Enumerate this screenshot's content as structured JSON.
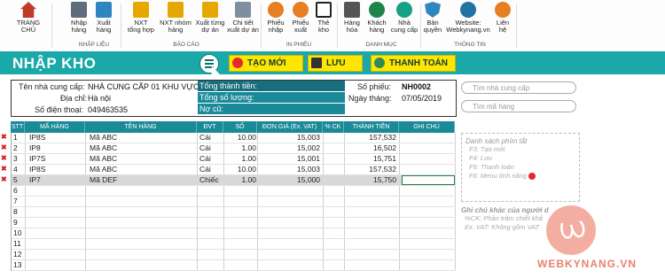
{
  "ribbon": {
    "buttons": [
      {
        "id": "trang-chu",
        "label": "TRANG\nCHỦ",
        "icon": "house-icon",
        "color": "#c0392b"
      },
      {
        "id": "nhap-hang",
        "label": "Nhập\nhàng",
        "icon": "pallet-import-icon",
        "color": "#5d6d7e"
      },
      {
        "id": "xuat-hang",
        "label": "Xuất\nhàng",
        "icon": "cart-export-icon",
        "color": "#2e86c1"
      },
      {
        "id": "nxt-tong-hop",
        "label": "NXT\ntổng hợp",
        "icon": "doc-summary-icon",
        "color": "#e6a700"
      },
      {
        "id": "nxt-nhom-hang",
        "label": "NXT nhóm\nhàng",
        "icon": "doc-group-icon",
        "color": "#e6a700"
      },
      {
        "id": "xuat-tung-du-an",
        "label": "Xuất từng\ndự án",
        "icon": "doc-project-icon",
        "color": "#e6a700"
      },
      {
        "id": "chi-tiet-xuat-du-an",
        "label": "Chi tiết\nxuất dự án",
        "icon": "doc-detail-icon",
        "color": "#7d8fa1"
      },
      {
        "id": "phieu-nhap",
        "label": "Phiếu\nnhập",
        "icon": "import-slip-icon",
        "color": "#e67e22"
      },
      {
        "id": "phieu-xuat",
        "label": "Phiếu\nxuất",
        "icon": "export-slip-icon",
        "color": "#e67e22"
      },
      {
        "id": "the-kho",
        "label": "Thẻ\nkho",
        "icon": "warehouse-card-icon",
        "color": "#222222"
      },
      {
        "id": "hang-hoa",
        "label": "Hàng\nhóa",
        "icon": "goods-icon",
        "color": "#555555"
      },
      {
        "id": "khach-hang",
        "label": "Khách\nhàng",
        "icon": "customers-icon",
        "color": "#1e8449"
      },
      {
        "id": "nha-cung-cap",
        "label": "Nhà\ncung cấp",
        "icon": "supplier-icon",
        "color": "#16a085"
      },
      {
        "id": "ban-quyen",
        "label": "Bản\nquyền",
        "icon": "shield-icon",
        "color": "#2e86c1"
      },
      {
        "id": "website",
        "label": "Website:\nWebkynang.vn",
        "icon": "globe-icon",
        "color": "#2471a3"
      },
      {
        "id": "lien-he",
        "label": "Liên\nhệ",
        "icon": "contact-icon",
        "color": "#e67e22"
      }
    ],
    "groups": [
      "NHẬP LIỆU",
      "BÁO CÁO",
      "IN PHIẾU",
      "DANH MỤC",
      "THÔNG TIN"
    ]
  },
  "header": {
    "title": "NHẬP KHO",
    "btn_new": "TẠO MỚI",
    "btn_save": "LƯU",
    "btn_pay": "THANH TOÁN",
    "accent": "#1aa8a8",
    "button_color": "#ffe600"
  },
  "info": {
    "supplier_label": "Tên nhà cung cấp:",
    "supplier_value": "NHÀ CUNG CẤP 01 KHU VỰC",
    "address_label": "Địa chỉ:",
    "address_value": "Hà nội",
    "phone_label": "Số điện thoại:",
    "phone_value": "049463535",
    "total_money_label": "Tổng thành tiền:",
    "total_qty_label": "Tổng số lượng:",
    "debt_label": "Nợ cũ:",
    "slip_no_label": "Số phiếu:",
    "slip_no_value": "NH0002",
    "date_label": "Ngày tháng:",
    "date_value": "07/05/2019"
  },
  "search": {
    "supplier_placeholder": "Tìm nhà cung cấp",
    "item_placeholder": "Tìm mã hàng"
  },
  "table": {
    "headers": [
      "STT",
      "MÃ HÀNG",
      "TÊN HÀNG",
      "ĐVT",
      "SỐ LƯỢNG",
      "ĐƠN GIÁ (Ex. VAT)",
      "% CK",
      "THÀNH TIỀN",
      "GHI CHÚ"
    ],
    "rows": [
      [
        "1",
        "IP8S",
        "Mã ABC",
        "Cái",
        "10.00",
        "15,003",
        "",
        "157,532",
        ""
      ],
      [
        "2",
        "IP8",
        "Mã ABC",
        "Cái",
        "1.00",
        "15,002",
        "",
        "16,502",
        ""
      ],
      [
        "3",
        "IP7S",
        "Mã ABC",
        "Cái",
        "1.00",
        "15,001",
        "",
        "15,751",
        ""
      ],
      [
        "4",
        "IP8S",
        "Mã ABC",
        "Cái",
        "10.00",
        "15,003",
        "",
        "157,532",
        ""
      ],
      [
        "5",
        "IP7",
        "Mã DEF",
        "Chiếc",
        "1.00",
        "15,000",
        "",
        "15,750",
        ""
      ],
      [
        "6",
        "",
        "",
        "",
        "",
        "",
        "",
        "",
        ""
      ],
      [
        "7",
        "",
        "",
        "",
        "",
        "",
        "",
        "",
        ""
      ],
      [
        "8",
        "",
        "",
        "",
        "",
        "",
        "",
        "",
        ""
      ],
      [
        "9",
        "",
        "",
        "",
        "",
        "",
        "",
        "",
        ""
      ],
      [
        "10",
        "",
        "",
        "",
        "",
        "",
        "",
        "",
        ""
      ],
      [
        "11",
        "",
        "",
        "",
        "",
        "",
        "",
        "",
        ""
      ],
      [
        "12",
        "",
        "",
        "",
        "",
        "",
        "",
        "",
        ""
      ],
      [
        "13",
        "",
        "",
        "",
        "",
        "",
        "",
        "",
        ""
      ]
    ],
    "delete_mark": "✖"
  },
  "side": {
    "shortcuts_title": "Danh sách phím tắt",
    "shortcuts": [
      "F3: Tạo mới",
      "F4: Lưu",
      "F5: Thanh toán",
      "F6: Menu tính năng"
    ],
    "notes_title": "Ghi chú khác của người d",
    "notes": [
      "%CK: Phần trăm chiết khấ",
      "Ex. VAT: Không gồm VAT"
    ]
  },
  "brand": {
    "watermark": "WEBKYNANG.VN"
  }
}
